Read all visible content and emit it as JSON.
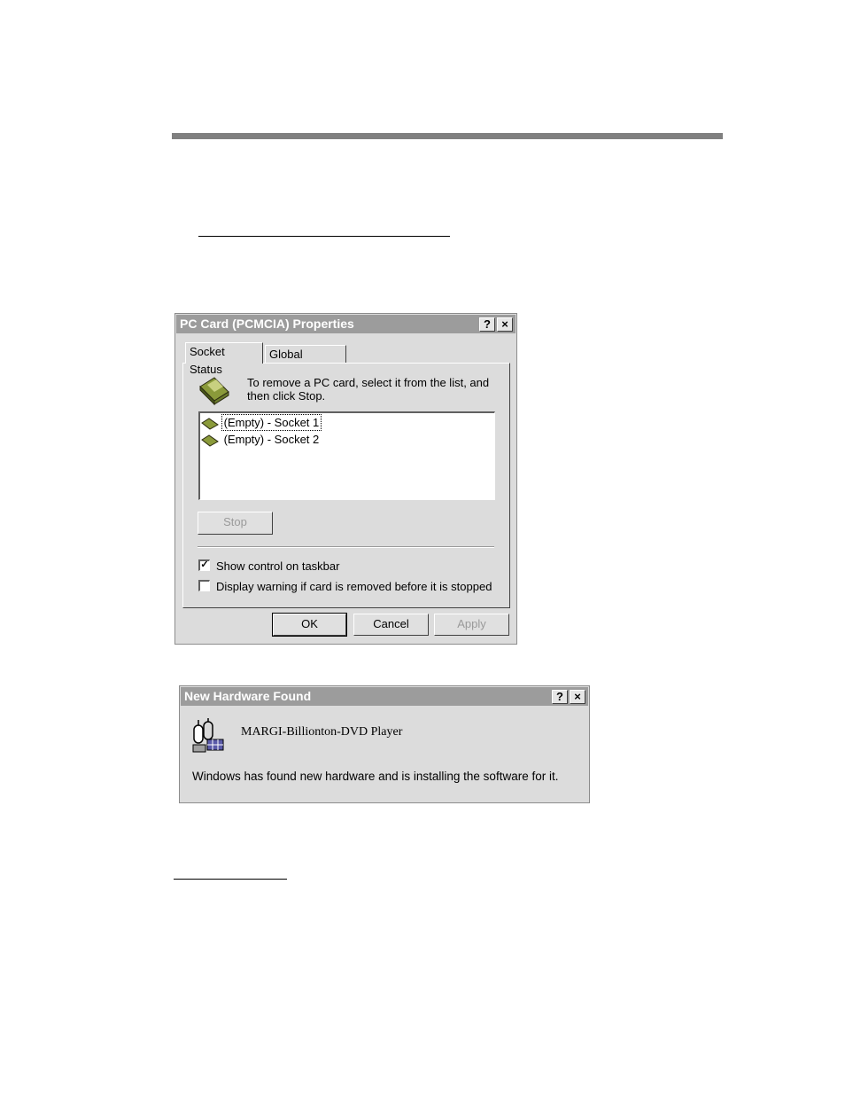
{
  "pcmcia_dialog": {
    "title": "PC Card (PCMCIA) Properties",
    "help_label": "?",
    "close_label": "×",
    "tabs": [
      {
        "label": "Socket Status"
      },
      {
        "label": "Global Settings"
      }
    ],
    "instruction": "To remove a PC card, select it from the list, and then click Stop.",
    "sockets": [
      {
        "label": "(Empty) - Socket 1"
      },
      {
        "label": "(Empty) - Socket 2"
      }
    ],
    "stop_label": "Stop",
    "show_control_label": "Show control on taskbar",
    "show_control_checked": "✓",
    "display_warning_label": "Display warning if card is removed before it is stopped",
    "ok_label": "OK",
    "cancel_label": "Cancel",
    "apply_label": "Apply"
  },
  "hardware_dialog": {
    "title": "New Hardware Found",
    "help_label": "?",
    "close_label": "×",
    "device_name": "MARGI-Billionton-DVD Player",
    "message": "Windows has found new hardware and is installing the software for it."
  },
  "colors": {
    "titlebar": "#9c9c9c",
    "dialog_face": "#dcdcdc",
    "rule": "#808080",
    "card_icon": "#8a9a3a"
  },
  "icons": [
    "pc-card-icon",
    "new-hardware-icon"
  ]
}
